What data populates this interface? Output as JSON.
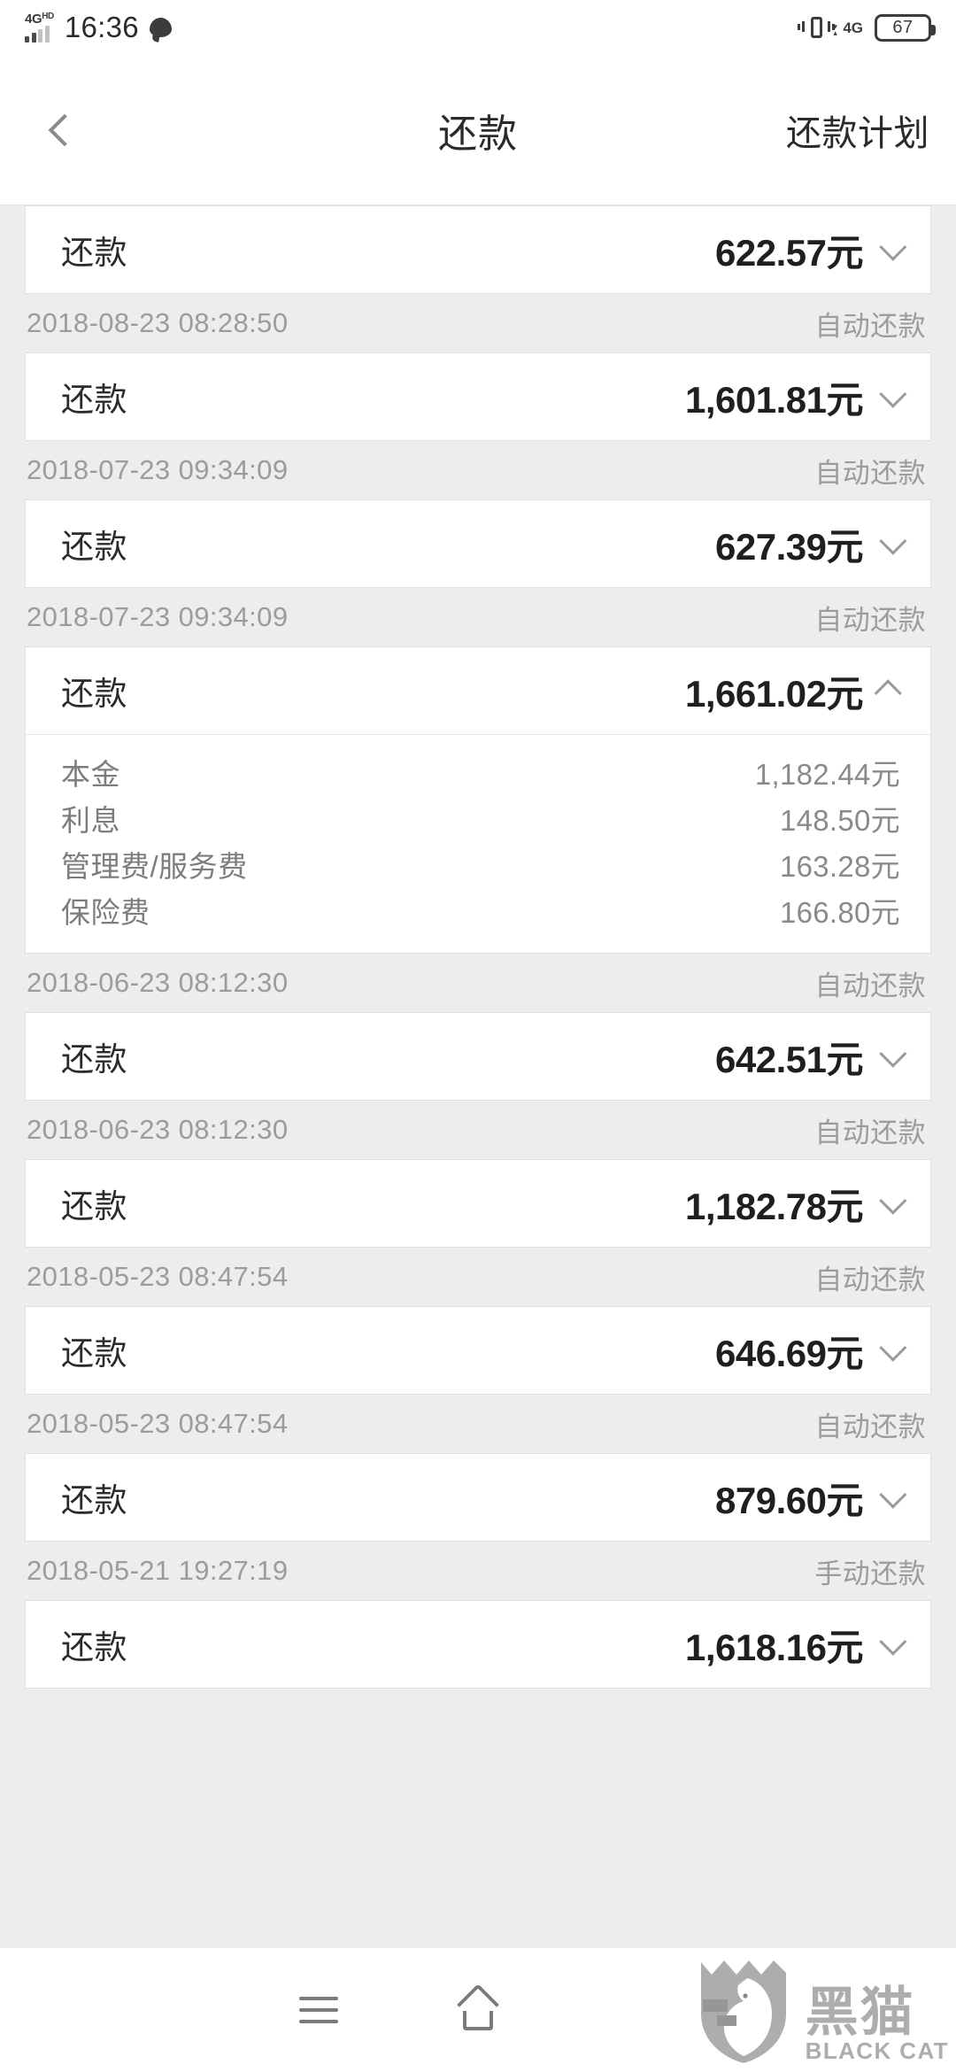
{
  "status_bar": {
    "network_label": "4G",
    "network_sup": "HD",
    "time": "16:36",
    "message_icon": "chat-bubble-icon",
    "vibrate_icon": "vibrate-icon",
    "data_network": "4G",
    "battery_percent": "67"
  },
  "header": {
    "back_icon": "chevron-left-icon",
    "title": "还款",
    "action_label": "还款计划"
  },
  "list": {
    "card_label": "还款",
    "items": [
      {
        "label": "还款",
        "amount": "622.57元",
        "expanded": false,
        "chevron": "chevron-down-icon",
        "date": "2018-08-23 08:28:50",
        "type": "自动还款"
      },
      {
        "label": "还款",
        "amount": "1,601.81元",
        "expanded": false,
        "chevron": "chevron-down-icon",
        "date": "2018-07-23 09:34:09",
        "type": "自动还款"
      },
      {
        "label": "还款",
        "amount": "627.39元",
        "expanded": false,
        "chevron": "chevron-down-icon",
        "date": "2018-07-23 09:34:09",
        "type": "自动还款"
      },
      {
        "label": "还款",
        "amount": "1,661.02元",
        "expanded": true,
        "chevron": "chevron-up-icon",
        "details": [
          {
            "label": "本金",
            "value": "1,182.44元"
          },
          {
            "label": "利息",
            "value": "148.50元"
          },
          {
            "label": "管理费/服务费",
            "value": "163.28元"
          },
          {
            "label": "保险费",
            "value": "166.80元"
          }
        ],
        "date": "2018-06-23 08:12:30",
        "type": "自动还款"
      },
      {
        "label": "还款",
        "amount": "642.51元",
        "expanded": false,
        "chevron": "chevron-down-icon",
        "date": "2018-06-23 08:12:30",
        "type": "自动还款"
      },
      {
        "label": "还款",
        "amount": "1,182.78元",
        "expanded": false,
        "chevron": "chevron-down-icon",
        "date": "2018-05-23 08:47:54",
        "type": "自动还款"
      },
      {
        "label": "还款",
        "amount": "646.69元",
        "expanded": false,
        "chevron": "chevron-down-icon",
        "date": "2018-05-23 08:47:54",
        "type": "自动还款"
      },
      {
        "label": "还款",
        "amount": "879.60元",
        "expanded": false,
        "chevron": "chevron-down-icon",
        "date": "2018-05-21 19:27:19",
        "type": "手动还款"
      },
      {
        "label": "还款",
        "amount": "1,618.16元",
        "expanded": false,
        "chevron": "chevron-down-icon",
        "date": "",
        "type": ""
      }
    ]
  },
  "navbar": {
    "recents_icon": "menu-icon",
    "home_icon": "home-icon"
  },
  "watermark": {
    "cn": "黑猫",
    "en": "BLACK CAT",
    "logo_icon": "black-cat-shield-icon"
  },
  "colors": {
    "page_bg": "#ededed",
    "card_bg": "#ffffff",
    "text_primary": "#1f1f1f",
    "text_muted": "#9c9c9c"
  }
}
